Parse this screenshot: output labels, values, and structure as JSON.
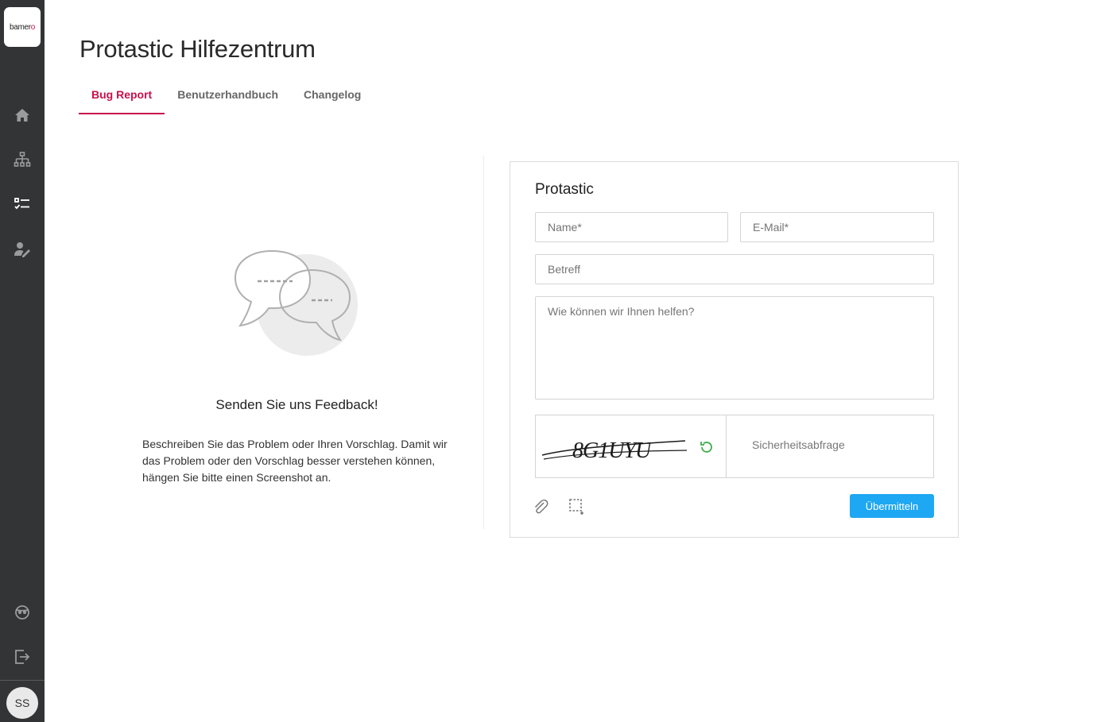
{
  "sidebar": {
    "logo_text": "bamer",
    "logo_accent": "o",
    "items": [
      {
        "name": "home-icon"
      },
      {
        "name": "sitemap-icon"
      },
      {
        "name": "checklist-icon"
      },
      {
        "name": "user-edit-icon"
      }
    ],
    "bottom_items": [
      {
        "name": "support-icon"
      },
      {
        "name": "logout-icon"
      }
    ],
    "avatar_initials": "SS"
  },
  "header": {
    "title": "Protastic Hilfezentrum"
  },
  "tabs": [
    {
      "label": "Bug Report",
      "active": true
    },
    {
      "label": "Benutzerhandbuch",
      "active": false
    },
    {
      "label": "Changelog",
      "active": false
    }
  ],
  "feedback": {
    "title": "Senden Sie uns Feedback!",
    "text": "Beschreiben Sie das Problem oder Ihren Vorschlag. Damit wir das Problem oder den Vorschlag besser verstehen können, hängen Sie bitte einen Screenshot an."
  },
  "form": {
    "title": "Protastic",
    "name_placeholder": "Name*",
    "email_placeholder": "E-Mail*",
    "subject_placeholder": "Betreff",
    "message_placeholder": "Wie können wir Ihnen helfen?",
    "captcha_code": "8G1UYU",
    "captcha_placeholder": "Sicherheitsabfrage",
    "submit_label": "Übermitteln"
  },
  "colors": {
    "accent": "#c8104a",
    "sidebar_bg": "#333435",
    "button_bg": "#1ea7f2",
    "refresh_icon": "#3fae49"
  }
}
